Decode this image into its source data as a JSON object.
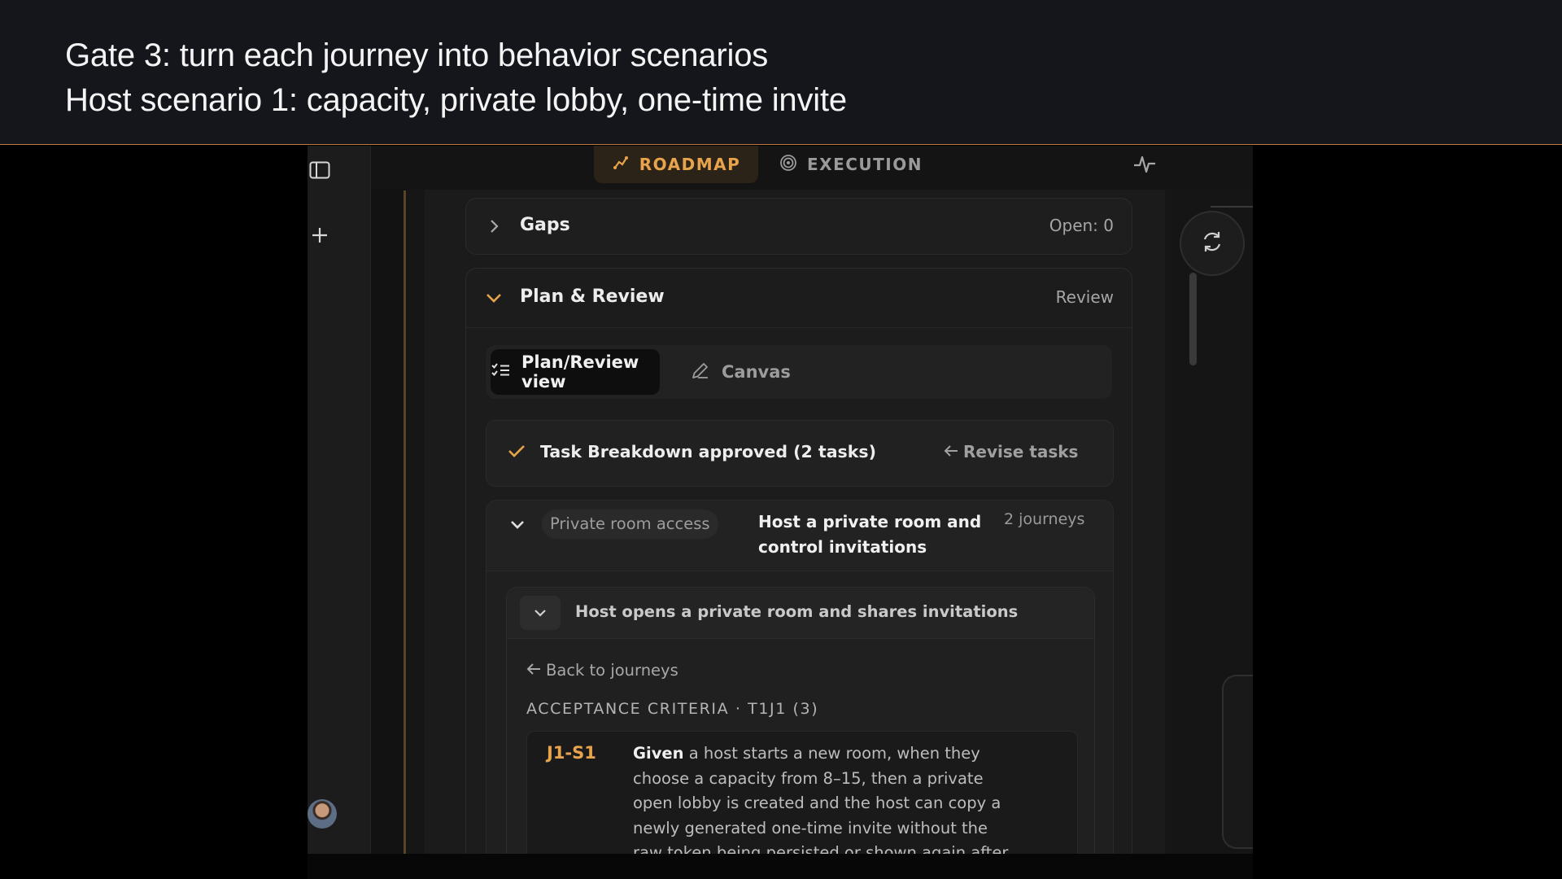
{
  "caption": {
    "line1": "Gate 3: turn each journey into behavior scenarios",
    "line2": "Host scenario 1: capacity, private lobby, one-time invite"
  },
  "tabs": [
    {
      "label": "ROADMAP",
      "icon": "sparkle-icon",
      "active": true
    },
    {
      "label": "EXECUTION",
      "icon": "target-icon",
      "active": false
    }
  ],
  "gaps": {
    "title": "Gaps",
    "status": "Open: 0"
  },
  "plan_review": {
    "title": "Plan & Review",
    "status": "Review",
    "views": [
      {
        "label": "Plan/Review view",
        "icon": "checklist-icon",
        "active": true
      },
      {
        "label": "Canvas",
        "icon": "pencil-icon",
        "active": false
      }
    ]
  },
  "task_breakdown": {
    "label": "Task Breakdown approved (2 tasks)",
    "action": "Revise tasks"
  },
  "task": {
    "tag": "Private room access",
    "title_line1": "Host a private room and",
    "title_line2": "control invitations",
    "count": "2 journeys"
  },
  "journey": {
    "title": "Host opens a private room and shares invitations",
    "back": "Back to journeys",
    "criteria_header": "ACCEPTANCE CRITERIA · T1J1 (3)"
  },
  "criteria": [
    {
      "id": "J1-S1",
      "keyword": "Given",
      "line1": " a host starts a new room, when they",
      "line2": "choose a capacity from 8–15, then a private",
      "line3": "open lobby is created and the host can copy a",
      "line4": "newly generated one-time invite without the",
      "line5": "raw token being persisted or shown again after"
    }
  ],
  "colors": {
    "accent": "#e8a44c",
    "background": "#161616",
    "caption_rule": "#c27a45"
  }
}
